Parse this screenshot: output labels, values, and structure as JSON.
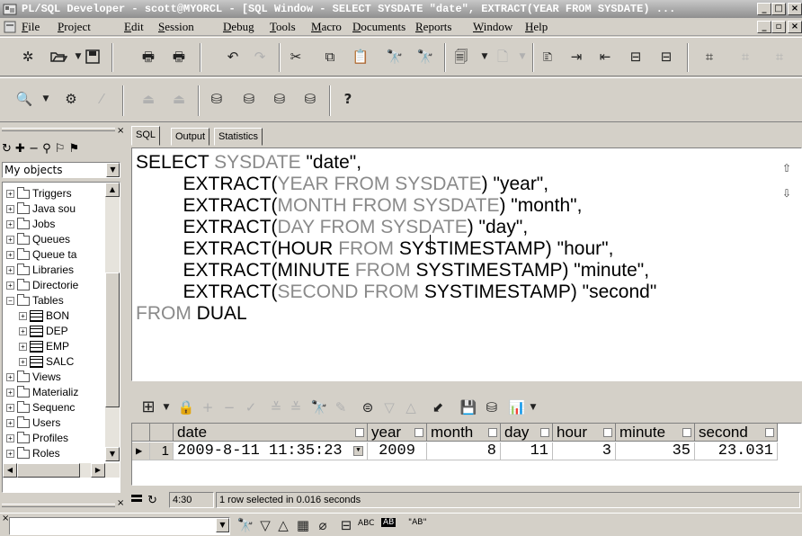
{
  "window": {
    "title": "PL/SQL Developer - scott@MYORCL - [SQL Window - SELECT SYSDATE \"date\", EXTRACT(YEAR FROM SYSDATE) ...",
    "min_label": "_",
    "max_label": "□",
    "close_label": "×",
    "child_min_label": "_",
    "child_restore_label": "▫",
    "child_close_label": "×"
  },
  "menu": [
    "File",
    "Project",
    "Edit",
    "Session",
    "Debug",
    "Tools",
    "Macro",
    "Documents",
    "Reports",
    "Window",
    "Help"
  ],
  "left_panel": {
    "filter_value": "My objects",
    "tree": [
      {
        "label": "Triggers",
        "type": "folder",
        "expander": "+"
      },
      {
        "label": "Java sou",
        "type": "folder",
        "expander": "+"
      },
      {
        "label": "Jobs",
        "type": "folder",
        "expander": "+"
      },
      {
        "label": "Queues",
        "type": "folder",
        "expander": "+"
      },
      {
        "label": "Queue ta",
        "type": "folder",
        "expander": "+"
      },
      {
        "label": "Libraries",
        "type": "folder",
        "expander": "+"
      },
      {
        "label": "Directorie",
        "type": "folder",
        "expander": "+"
      },
      {
        "label": "Tables",
        "type": "folder",
        "expander": "−"
      },
      {
        "label": "BON",
        "type": "table",
        "expander": "+"
      },
      {
        "label": "DEP",
        "type": "table",
        "expander": "+"
      },
      {
        "label": "EMP",
        "type": "table",
        "expander": "+"
      },
      {
        "label": "SALC",
        "type": "table",
        "expander": "+"
      },
      {
        "label": "Views",
        "type": "folder",
        "expander": "+"
      },
      {
        "label": "Materializ",
        "type": "folder",
        "expander": "+"
      },
      {
        "label": "Sequenc",
        "type": "folder",
        "expander": "+"
      },
      {
        "label": "Users",
        "type": "folder",
        "expander": "+"
      },
      {
        "label": "Profiles",
        "type": "folder",
        "expander": "+"
      },
      {
        "label": "Roles",
        "type": "folder",
        "expander": "+"
      }
    ]
  },
  "tabs": [
    "SQL",
    "Output",
    "Statistics"
  ],
  "editor": {
    "lines": [
      {
        "indent": "",
        "parts": [
          [
            "kw",
            "SELECT "
          ],
          [
            "gray",
            "SYSDATE "
          ],
          [
            "str",
            "\"date\","
          ]
        ]
      },
      {
        "indent": "         ",
        "parts": [
          [
            "fn",
            "EXTRACT("
          ],
          [
            "gray",
            "YEAR FROM SYSDATE"
          ],
          [
            "fn",
            ") "
          ],
          [
            "str",
            "\"year\","
          ]
        ]
      },
      {
        "indent": "         ",
        "parts": [
          [
            "fn",
            "EXTRACT("
          ],
          [
            "gray",
            "MONTH FROM SYSDATE"
          ],
          [
            "fn",
            ") "
          ],
          [
            "str",
            "\"month\","
          ]
        ]
      },
      {
        "indent": "         ",
        "parts": [
          [
            "fn",
            "EXTRACT("
          ],
          [
            "gray",
            "DAY FROM "
          ],
          [
            "gray",
            "SYSDATE"
          ],
          [
            "fn",
            ") "
          ],
          [
            "str",
            "\"day\","
          ]
        ]
      },
      {
        "indent": "         ",
        "parts": [
          [
            "fn",
            "EXTRACT(HOUR "
          ],
          [
            "gray",
            "FROM "
          ],
          [
            "fn",
            "SYSTIMESTAMP) "
          ],
          [
            "str",
            "\"hour\","
          ]
        ]
      },
      {
        "indent": "         ",
        "parts": [
          [
            "fn",
            "EXTRACT(MINUTE "
          ],
          [
            "gray",
            "FROM "
          ],
          [
            "fn",
            "SYSTIMESTAMP) "
          ],
          [
            "str",
            "\"minute\","
          ]
        ]
      },
      {
        "indent": "         ",
        "parts": [
          [
            "fn",
            "EXTRACT("
          ],
          [
            "gray",
            "SECOND FROM "
          ],
          [
            "fn",
            "SYSTIMESTAMP) "
          ],
          [
            "str",
            "\"second\""
          ]
        ]
      },
      {
        "indent": "",
        "parts": [
          [
            "gray",
            "FROM "
          ],
          [
            "kw",
            "DUAL"
          ]
        ]
      }
    ]
  },
  "grid": {
    "columns": [
      "date",
      "year",
      "month",
      "day",
      "hour",
      "minute",
      "second"
    ],
    "rows": [
      {
        "num": "1",
        "cells": [
          "2009-8-11 11:35:23",
          "2009",
          "8",
          "11",
          "3",
          "35",
          "23.031"
        ]
      }
    ]
  },
  "status": {
    "position": "4:30",
    "message": "1 row selected in 0.016 seconds"
  },
  "findbar": {
    "labels": [
      "ABC",
      "AB",
      "\"AB\""
    ]
  }
}
